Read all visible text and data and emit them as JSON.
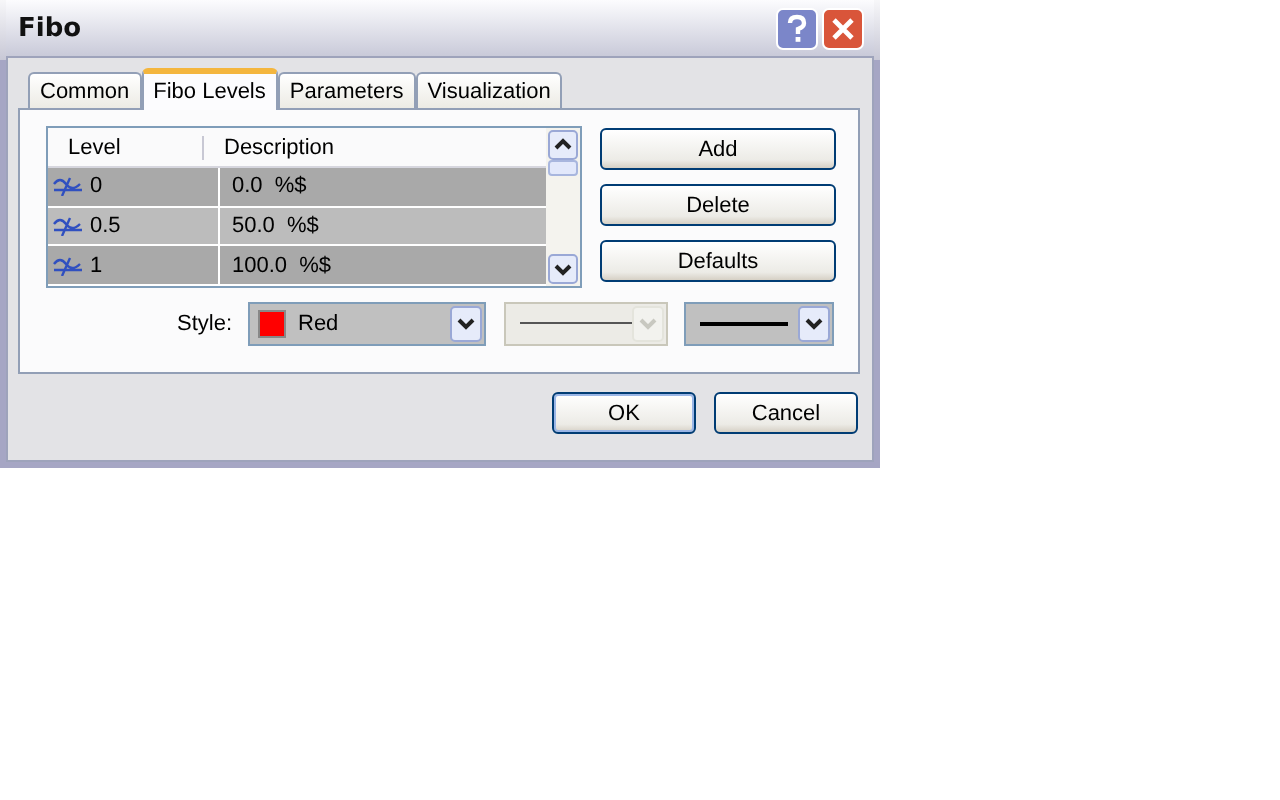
{
  "window": {
    "title": "Fibo"
  },
  "tabs": [
    {
      "label": "Common",
      "selected": false
    },
    {
      "label": "Fibo Levels",
      "selected": true
    },
    {
      "label": "Parameters",
      "selected": false
    },
    {
      "label": "Visualization",
      "selected": false
    }
  ],
  "levels": {
    "columns": [
      "Level",
      "Description"
    ],
    "rows": [
      {
        "level": "0",
        "description": "0.0  %$"
      },
      {
        "level": "0.5",
        "description": "50.0  %$"
      },
      {
        "level": "1",
        "description": "100.0  %$"
      }
    ]
  },
  "side_buttons": [
    "Add",
    "Delete",
    "Defaults"
  ],
  "style": {
    "label": "Style:",
    "color_name": "Red",
    "color": "#ff0000",
    "line_style_disabled": true,
    "line_width_disabled": false
  },
  "buttons": [
    "OK",
    "Cancel"
  ]
}
